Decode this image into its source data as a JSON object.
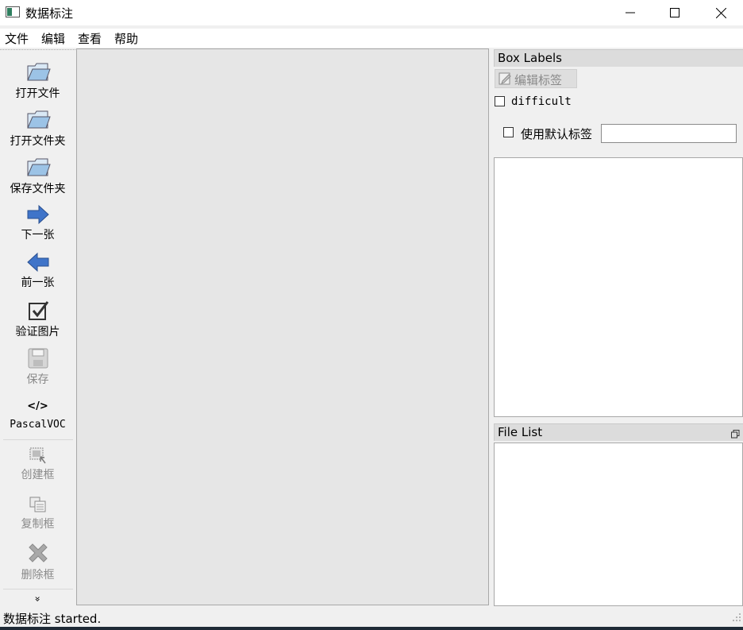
{
  "window": {
    "title": "数据标注"
  },
  "menu": [
    "文件",
    "编辑",
    "查看",
    "帮助"
  ],
  "toolbar": {
    "open_file": "打开文件",
    "open_dir": "打开文件夹",
    "save_dir": "保存文件夹",
    "next": "下一张",
    "prev": "前一张",
    "verify": "验证图片",
    "save": "保存",
    "format_icon": "</>",
    "format": "PascalVOC",
    "create_box": "创建框",
    "copy_box": "复制框",
    "delete_box": "删除框",
    "more": "»"
  },
  "box_labels": {
    "title": "Box Labels",
    "edit_label_button": "编辑标签",
    "difficult_label": "difficult",
    "difficult_checked": false,
    "use_default_label": "使用默认标签",
    "use_default_checked": false,
    "default_label_value": ""
  },
  "file_list": {
    "title": "File List"
  },
  "status": {
    "text": "数据标注 started."
  },
  "colors": {
    "arrow_blue": "#3f74c9",
    "folder_blue": "#9cc3e6",
    "check_dark": "#333333",
    "disabled_gray": "#8a8a8a"
  }
}
